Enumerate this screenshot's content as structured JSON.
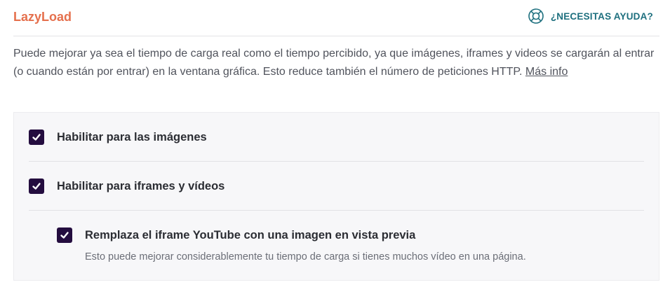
{
  "header": {
    "title": "LazyLoad",
    "help_label": "¿NECESITAS AYUDA?"
  },
  "description": {
    "text": "Puede mejorar ya sea el tiempo de carga real como el tiempo percibido, ya que imágenes, iframes y videos se cargarán al entrar (o cuando están por entrar) en la ventana gráfica. Esto reduce también el número de peticiones HTTP.",
    "link": "Más info"
  },
  "options": {
    "images": {
      "label": "Habilitar para las imágenes",
      "checked": true
    },
    "iframes": {
      "label": "Habilitar para iframes y vídeos",
      "checked": true
    },
    "youtube": {
      "label": "Remplaza el iframe YouTube con una imagen en vista previa",
      "description": "Esto puede mejorar considerablemente tu tiempo de carga si tienes muchos vídeo en una página.",
      "checked": true
    }
  },
  "colors": {
    "title": "#e5704d",
    "help": "#1d6f7e",
    "checkbox": "#240d3f"
  },
  "icons": {
    "help": "lifebuoy-icon",
    "check": "check-icon"
  }
}
